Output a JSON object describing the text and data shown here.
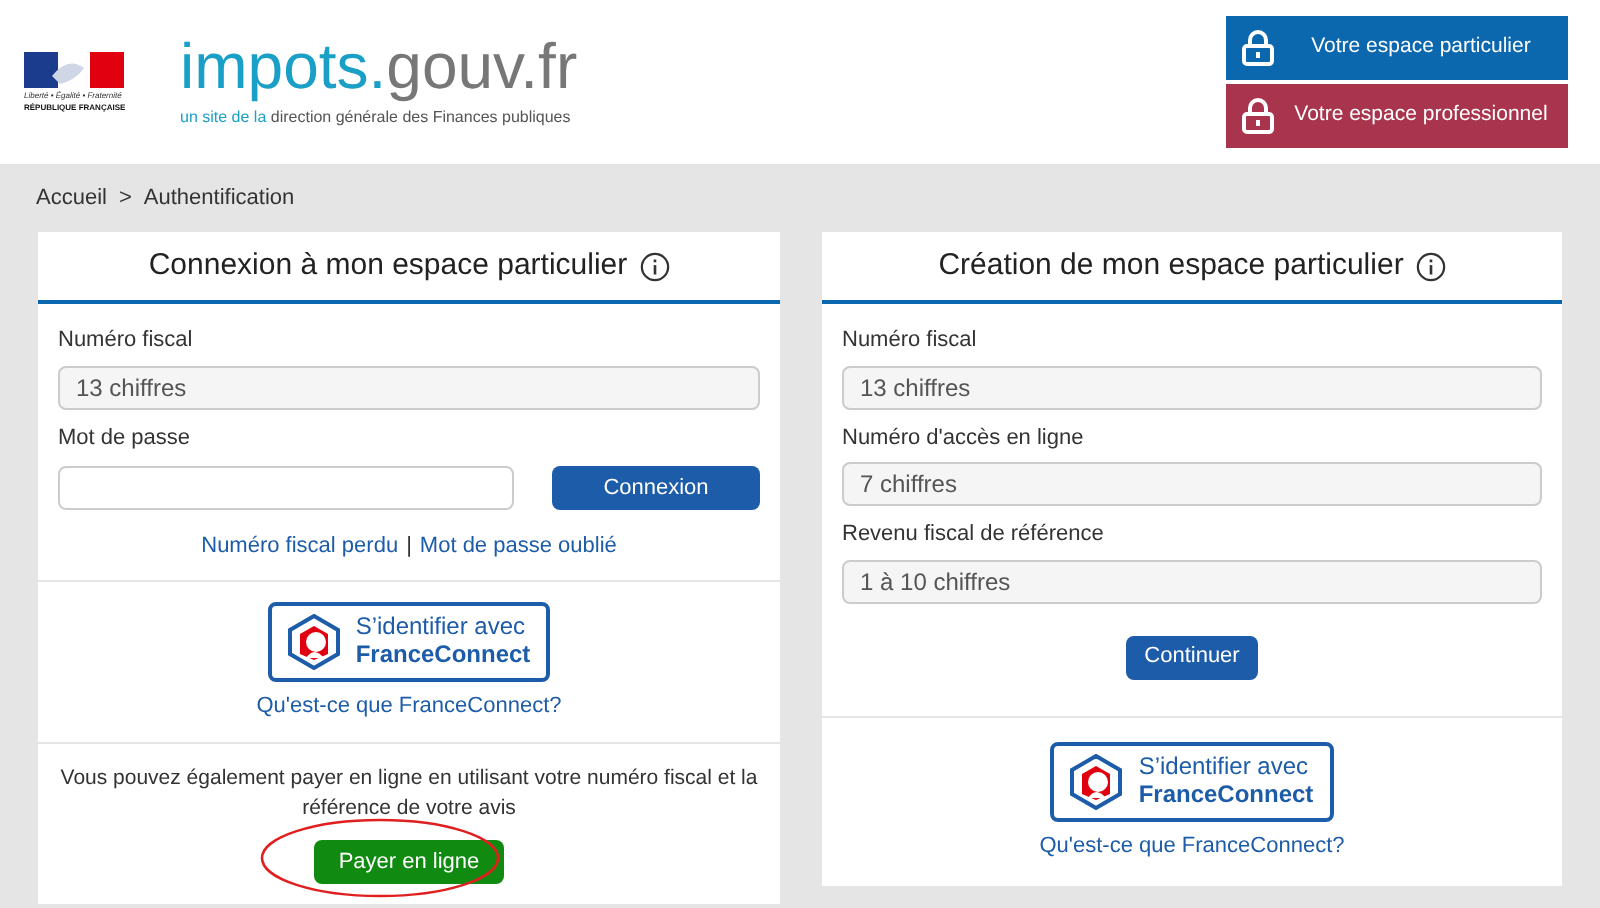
{
  "header": {
    "motto": "Liberté • Égalité • Fraternité",
    "republic": "RÉPUBLIQUE FRANÇAISE",
    "site_name_main": "impots.",
    "site_name_rest": "gouv.fr",
    "tagline_start": "un site de la",
    "tagline_end": "direction générale des Finances publiques",
    "space_buttons": [
      {
        "label": "Votre espace particulier",
        "color": "#0b67ae"
      },
      {
        "label": "Votre espace professionnel",
        "color": "#a9344d"
      }
    ]
  },
  "breadcrumb": {
    "home": "Accueil",
    "separator": ">",
    "current": "Authentification"
  },
  "login_card": {
    "title": "Connexion à mon espace particulier",
    "fields": [
      {
        "label": "Numéro fiscal",
        "placeholder": "13 chiffres"
      }
    ],
    "password": {
      "label": "Mot de passe"
    },
    "submit": "Connexion",
    "lost_number": "Numéro fiscal perdu",
    "link_separator": "|",
    "forgot_password": "Mot de passe oublié",
    "franceconnect": {
      "line1": "S’identifier avec",
      "line2": "FranceConnect",
      "help": "Qu'est-ce que FranceConnect?"
    },
    "pay_text": "Vous pouvez également payer en ligne en utilisant votre numéro fiscal et la référence de votre avis",
    "pay_button": "Payer en ligne",
    "pay_button_circled": true
  },
  "create_card": {
    "title": "Création de mon espace particulier",
    "fields": [
      {
        "label": "Numéro fiscal",
        "placeholder": "13 chiffres"
      },
      {
        "label": "Numéro d'accès en ligne",
        "placeholder": "7 chiffres"
      },
      {
        "label": "Revenu fiscal de référence",
        "placeholder": "1 à 10 chiffres"
      }
    ],
    "submit": "Continuer",
    "franceconnect": {
      "line1": "S’identifier avec",
      "line2": "FranceConnect",
      "help": "Qu'est-ce que FranceConnect?"
    }
  }
}
